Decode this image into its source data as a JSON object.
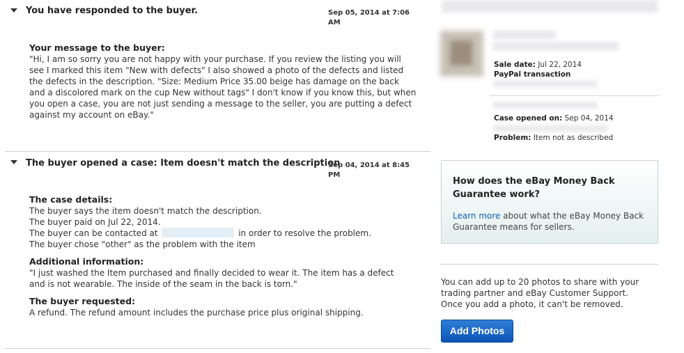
{
  "case_history": [
    {
      "title": "You have responded to the buyer.",
      "date": "Sep 05, 2014 at 7:06 AM",
      "message_heading": "Your message to the buyer:",
      "message": "\"Hi, I am so sorry you are not happy with your purchase. If you review the listing you will see I marked this item \"New with defects\" I also showed a photo of the defects and listed the defects in the description. \"Size: Medium Price 35.00 beige has damage on the back and a discolored mark on the cup New without tags\" I don't know if you know this, but when you open a case, you are not just sending a message to the seller, you are putting a defect against my account on eBay.\""
    },
    {
      "title": "The buyer opened a case: Item doesn't match the description",
      "date": "Sep 04, 2014 at 8:45 PM",
      "details_heading": "The case details:",
      "details_lines": [
        "The buyer says the item doesn't match the description.",
        "The buyer paid on Jul 22, 2014.",
        "The buyer can be contacted at",
        "in order to resolve the problem.",
        "The buyer chose \"other\" as the problem with the item"
      ],
      "additional_heading": "Additional information:",
      "additional_text": "\"I just washed the Item purchased and finally decided to wear it. The item has a defect and is not wearable. The inside of the seam in the back is torn.\"",
      "requested_heading": "The buyer requested:",
      "requested_text": "A refund. The refund amount includes the purchase price plus original shipping."
    }
  ],
  "sidebar": {
    "sale_date_label": "Sale date:",
    "sale_date": "Jul 22, 2014",
    "paypal_label": "PayPal transaction",
    "case_opened_label": "Case opened on:",
    "case_opened": "Sep 04, 2014",
    "problem_label": "Problem:",
    "problem": "Item not as described"
  },
  "guarantee": {
    "title": "How does the eBay Money Back Guarantee work?",
    "link": "Learn more",
    "text": " about what the eBay Money Back Guarantee means for sellers."
  },
  "photos": {
    "text": "You can add up to 20 photos to share with your trading partner and eBay Customer Support. Once you add a photo, it can't be removed.",
    "button": "Add Photos"
  },
  "colors": {
    "link": "#0d5fb0",
    "button": "#0d54b6"
  },
  "icons": [
    "collapse-triangle-icon"
  ]
}
